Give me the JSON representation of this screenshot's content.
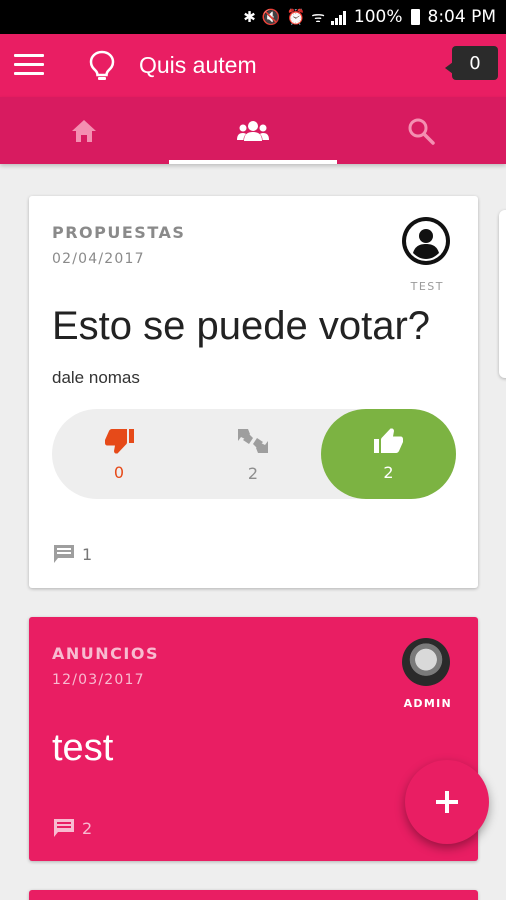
{
  "status_bar": {
    "battery": "100%",
    "time": "8:04 PM"
  },
  "app_bar": {
    "title": "Quis autem",
    "notification_count": "0"
  },
  "tabs": [
    {
      "name": "home",
      "icon": "home-icon",
      "active": false
    },
    {
      "name": "groups",
      "icon": "group-icon",
      "active": true
    },
    {
      "name": "search",
      "icon": "search-icon",
      "active": false
    }
  ],
  "posts": [
    {
      "category": "PROPUESTAS",
      "date": "02/04/2017",
      "author": "TEST",
      "title": "Esto se puede votar?",
      "body": "dale nomas",
      "votes": {
        "down": "0",
        "neutral": "2",
        "up": "2"
      },
      "comments": "1"
    },
    {
      "category": "ANUNCIOS",
      "date": "12/03/2017",
      "author": "ADMIN",
      "title": "test",
      "comments": "2"
    }
  ],
  "colors": {
    "primary": "#e91e63",
    "primary_dark": "#d81b60",
    "vote_up": "#7cb342",
    "vote_down": "#e64a19"
  }
}
